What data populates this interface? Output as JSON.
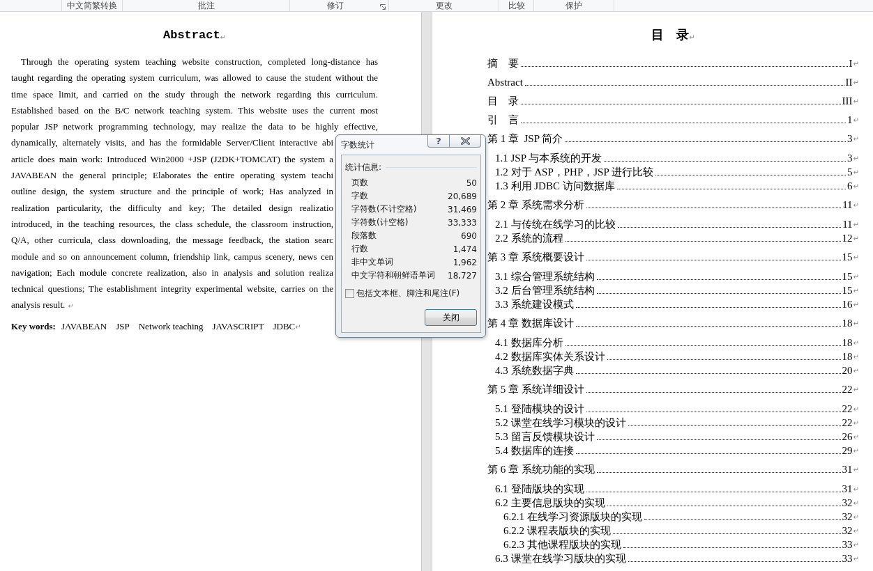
{
  "ribbon_groups": [
    {
      "label": "中文简繁转换",
      "dialog_launcher": false
    },
    {
      "label": "批注",
      "dialog_launcher": false
    },
    {
      "label": "修订",
      "dialog_launcher": true
    },
    {
      "label": "更改",
      "dialog_launcher": false
    },
    {
      "label": "比较",
      "dialog_launcher": false
    },
    {
      "label": "保护",
      "dialog_launcher": false
    }
  ],
  "abstract_page": {
    "title": "Abstract",
    "title_mark": "↵",
    "lines": [
      "Through the operating system teaching website construction, completed long-distance has",
      "taught regarding the operating system curriculum, was allowed to cause the student without the",
      "time space limit, and carried on the study through the network regarding this curriculum.",
      "Established based on the B/C network teaching system. This website uses the current most",
      "popular JSP network programming technology, may realize the data to be highly effective,",
      "dynamically, alternately visits, and has the formidable Server/Client interactive abi",
      "article does main work: Introduced Win2000 +JSP (J2DK+TOMCAT) the system a",
      "JAVABEAN the general principle; Elaborates the entire operating system teachi",
      "outline design, the system structure and the principle of work; Has analyzed in",
      "realization particularity, the difficulty and key; The detailed design realizatio",
      "introduced, in the teaching resources, the class schedule, the classroom instruction,",
      "Q/A, other curricula, class downloading, the message feedback, the station searc",
      "module and so on announcement column, friendship link, campus scenery, news cen",
      "navigation; Each module concrete realization, also in analysis and solution realiza",
      "technical questions; The establishment integrity experimental website, carries on the",
      "analysis result."
    ],
    "end_mark": "↵",
    "keywords": {
      "label": "Key words:",
      "items": [
        "JAVABEAN",
        "JSP",
        "Network teaching",
        "JAVASCRIPT",
        "JDBC"
      ],
      "mark": "↵"
    }
  },
  "word_count_dialog": {
    "title": "字数统计",
    "help_button": "?",
    "group_label": "统计信息:",
    "statistics": [
      {
        "label": "页数",
        "value": "50"
      },
      {
        "label": "字数",
        "value": "20,689"
      },
      {
        "label": "字符数(不计空格)",
        "value": "31,469"
      },
      {
        "label": "字符数(计空格)",
        "value": "33,333"
      },
      {
        "label": "段落数",
        "value": "690"
      },
      {
        "label": "行数",
        "value": "1,474"
      },
      {
        "label": "非中文单词",
        "value": "1,962"
      },
      {
        "label": "中文字符和朝鲜语单词",
        "value": "18,727"
      }
    ],
    "checkbox": {
      "label": "包括文本框、脚注和尾注(F)",
      "checked": false
    },
    "close_button": "关闭"
  },
  "toc_page": {
    "title": "目　录",
    "title_mark": "↵",
    "entries": [
      {
        "text": "摘　要",
        "page": "I",
        "mark": "↵"
      },
      {
        "text": "Abstract",
        "page": "II",
        "mark": "↵"
      },
      {
        "text": "目　录",
        "page": "III",
        "mark": "↵"
      },
      {
        "text": "引　言",
        "page": "1",
        "mark": "↵"
      },
      {
        "text": "第 1 章  JSP 简介",
        "page": "3",
        "mark": "↵",
        "children": [
          {
            "text": "1.1 JSP 与本系统的开发",
            "page": "3",
            "mark": "↵"
          },
          {
            "text": "1.2 对于 ASP，PHP，JSP 进行比较",
            "page": "5",
            "mark": "↵"
          },
          {
            "text": "1.3 利用 JDBC 访问数据库",
            "page": "6",
            "mark": "↵"
          }
        ]
      },
      {
        "text": "第 2 章 系统需求分析",
        "page": "11",
        "mark": "↵",
        "children": [
          {
            "text": "2.1 与传统在线学习的比较",
            "page": "11",
            "mark": "↵"
          },
          {
            "text": "2.2 系统的流程",
            "page": "12",
            "mark": "↵"
          }
        ]
      },
      {
        "text": "第 3 章 系统概要设计",
        "page": "15",
        "mark": "↵",
        "children": [
          {
            "text": "3.1 综合管理系统结构",
            "page": "15",
            "mark": "↵"
          },
          {
            "text": "3.2 后台管理系统结构",
            "page": "15",
            "mark": "↵"
          },
          {
            "text": "3.3 系统建设模式",
            "page": "16",
            "mark": "↵"
          }
        ]
      },
      {
        "text": "第 4 章 数据库设计",
        "page": "18",
        "mark": "↵",
        "children": [
          {
            "text": "4.1 数据库分析",
            "page": "18",
            "mark": "↵"
          },
          {
            "text": "4.2 数据库实体关系设计",
            "page": "18",
            "mark": "↵"
          },
          {
            "text": "4.3 系统数据字典",
            "page": "20",
            "mark": "↵"
          }
        ]
      },
      {
        "text": "第 5 章 系统详细设计",
        "page": "22",
        "mark": "↵",
        "children": [
          {
            "text": "5.1 登陆模块的设计",
            "page": "22",
            "mark": "↵"
          },
          {
            "text": "5.2 课堂在线学习模块的设计",
            "page": "22",
            "mark": "↵"
          },
          {
            "text": "5.3 留言反馈模块设计",
            "page": "26",
            "mark": "↵"
          },
          {
            "text": "5.4 数据库的连接",
            "page": "29",
            "mark": "↵"
          }
        ]
      },
      {
        "text": "第 6 章 系统功能的实现",
        "page": "31",
        "mark": "↵",
        "children": [
          {
            "text": "6.1 登陆版块的实现",
            "page": "31",
            "mark": "↵"
          },
          {
            "text": "6.2 主要信息版块的实现",
            "page": "32",
            "mark": "↵",
            "children": [
              {
                "text": "6.2.1 在线学习资源版块的实现",
                "page": "32",
                "mark": "↵"
              },
              {
                "text": "6.2.2 课程表版块的实现",
                "page": "32",
                "mark": "↵"
              },
              {
                "text": "6.2.3 其他课程版块的实现",
                "page": "33",
                "mark": "↵"
              }
            ]
          },
          {
            "text": "6.3 课堂在线学习版块的实现",
            "page": "33",
            "mark": "↵"
          }
        ]
      }
    ]
  }
}
